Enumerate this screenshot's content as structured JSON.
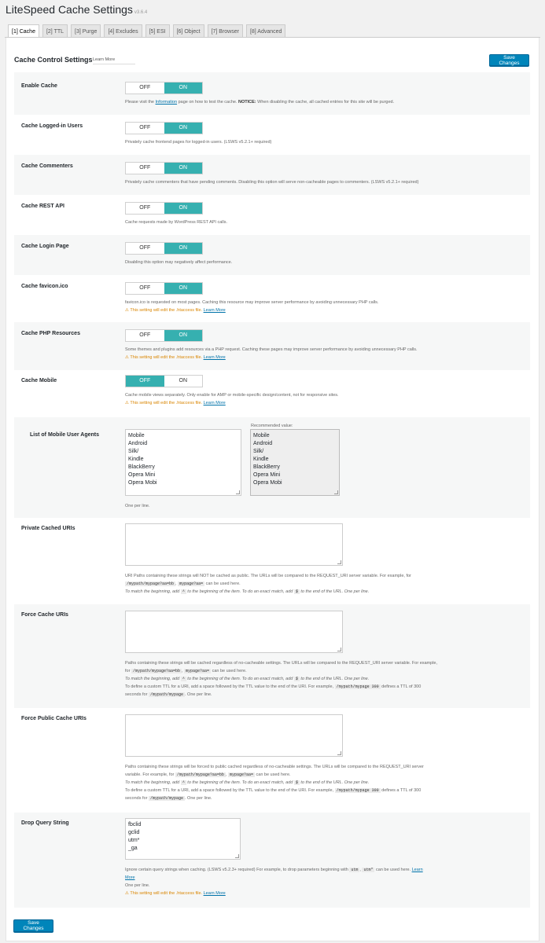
{
  "header": {
    "title": "LiteSpeed Cache Settings",
    "version": "v3.6.4"
  },
  "tabs": [
    {
      "label": "[1] Cache"
    },
    {
      "label": "[2] TTL"
    },
    {
      "label": "[3] Purge"
    },
    {
      "label": "[4] Excludes"
    },
    {
      "label": "[5] ESI"
    },
    {
      "label": "[6] Object"
    },
    {
      "label": "[7] Browser"
    },
    {
      "label": "[8] Advanced"
    }
  ],
  "active_tab": 0,
  "section": {
    "title": "Cache Control Settings",
    "learn_more": "Learn More",
    "save_label": "Save Changes"
  },
  "toggle": {
    "off": "OFF",
    "on": "ON"
  },
  "settings": {
    "enable_cache": {
      "label": "Enable Cache",
      "value": "ON",
      "desc_pre": "Please visit the ",
      "desc_link": "Information",
      "desc_mid": " page on how to test the cache. ",
      "desc_notice": "NOTICE:",
      "desc_post": " When disabling the cache, all cached entries for this site will be purged."
    },
    "cache_logged_in": {
      "label": "Cache Logged-in Users",
      "value": "ON",
      "desc": "Privately cache frontend pages for logged-in users. (LSWS v5.2.1+ required)"
    },
    "cache_commenters": {
      "label": "Cache Commenters",
      "value": "ON",
      "desc": "Privately cache commenters that have pending comments. Disabling this option will serve non-cacheable pages to commenters. (LSWS v5.2.1+ required)"
    },
    "cache_rest": {
      "label": "Cache REST API",
      "value": "ON",
      "desc": "Cache requests made by WordPress REST API calls."
    },
    "cache_login": {
      "label": "Cache Login Page",
      "value": "ON",
      "desc": "Disabling this option may negatively affect performance."
    },
    "cache_favicon": {
      "label": "Cache favicon.ico",
      "value": "ON",
      "desc": "favicon.ico is requested on most pages. Caching this resource may improve server performance by avoiding unnecessary PHP calls."
    },
    "cache_php": {
      "label": "Cache PHP Resources",
      "value": "ON",
      "desc": "Some themes and plugins add resources via a PHP request. Caching these pages may improve server performance by avoiding unnecessary PHP calls."
    },
    "cache_mobile": {
      "label": "Cache Mobile",
      "value": "OFF",
      "desc": "Cache mobile views separately. Only enable for AMP or mobile-specific design/content, not for responsive sites."
    },
    "mobile_agents": {
      "label": "List of Mobile User Agents",
      "values": [
        "Mobile",
        "Android",
        "Silk/",
        "Kindle",
        "BlackBerry",
        "Opera Mini",
        "Opera Mobi"
      ],
      "recommended_label": "Recommended value:",
      "recommended": [
        "Mobile",
        "Android",
        "Silk/",
        "Kindle",
        "BlackBerry",
        "Opera Mini",
        "Opera Mobi"
      ],
      "desc": "One per line."
    },
    "private_uris": {
      "label": "Private Cached URIs",
      "desc1": "URI Paths containing these strings will NOT be cached as public. The URLs will be compared to the REQUEST_URI server variable. For example, for",
      "code1": "/mypath/mypage?aa=bb",
      "code2": "mypage?aa=",
      "desc2": " can be used here.",
      "it1": "To match the beginning, add ",
      "code3": "^",
      "it2": " to the beginning of the item. To do an exact match, add ",
      "code4": "$",
      "it3": " to the end of the URL. One per line."
    },
    "force_uris": {
      "label": "Force Cache URIs",
      "desc1": "Paths containing these strings will be cached regardless of no-cacheable settings. The URLs will be compared to the REQUEST_URI server variable. For example,",
      "for": "for ",
      "code1": "/mypath/mypage?aa=bb",
      "code2": "mypage?aa=",
      "desc2": " can be used here.",
      "it1": "To match the beginning, add ",
      "code3": "^",
      "it2": " to the beginning of the item. To do an exact match, add ",
      "code4": "$",
      "it3": " to the end of the URL. One per line.",
      "ttl1": "To define a custom TTL for a URI, add a space followed by the TTL value to the end of the URI. For example, ",
      "code5": "/mypath/mypage 300",
      "ttl2": " defines a TTL of 300",
      "ttl3": "seconds for ",
      "code6": "/mypath/mypage",
      "ttl4": ". One per line."
    },
    "force_public_uris": {
      "label": "Force Public Cache URIs",
      "desc1": "Paths containing these strings will be forced to public cached regardless of no-cacheable settings. The URLs will be compared to the REQUEST_URI server",
      "desc1b": "variable. For example, for ",
      "code1": "/mypath/mypage?aa=bb",
      "code2": "mypage?aa=",
      "desc2": " can be used here.",
      "it1": "To match the beginning, add ",
      "code3": "^",
      "it2": " to the beginning of the item. To do an exact match, add ",
      "code4": "$",
      "it3": " to the end of the URL. One per line.",
      "ttl1": "To define a custom TTL for a URI, add a space followed by the TTL value to the end of the URI. For example, ",
      "code5": "/mypath/mypage 300",
      "ttl2": " defines a TTL of 300",
      "ttl3": "seconds for ",
      "code6": "/mypath/mypage",
      "ttl4": ". One per line."
    },
    "drop_qs": {
      "label": "Drop Query String",
      "values": [
        "fbclid",
        "gclid",
        "utm*",
        "_ga"
      ],
      "desc_pre": "Ignore certain query strings when caching. (LSWS v5.2.3+ required) For example, to drop parameters beginning with ",
      "code1": "utm",
      "code2": "utm*",
      "desc_post": " can be used here. ",
      "desc_link": "Learn",
      "desc_link2": "More",
      "desc2": "One per line."
    }
  },
  "htaccess_warning": {
    "text": "⚠ This setting will edit the .htaccess file. ",
    "link": "Learn More"
  }
}
